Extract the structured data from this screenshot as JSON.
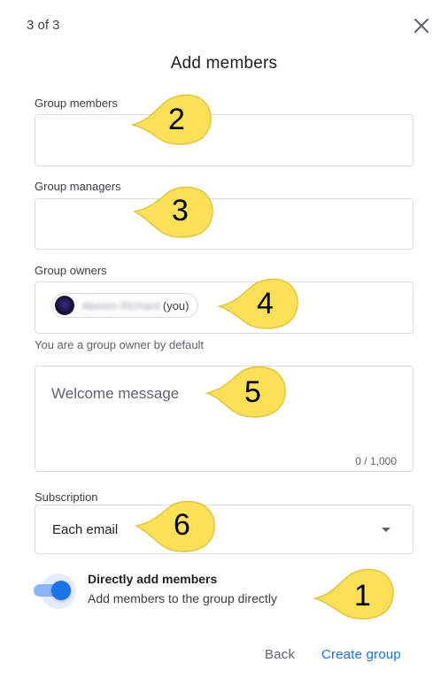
{
  "header": {
    "step": "3 of 3",
    "title": "Add members",
    "close_icon": "close-icon"
  },
  "fields": {
    "group_members": {
      "label": "Group members",
      "value": ""
    },
    "group_managers": {
      "label": "Group managers",
      "value": ""
    },
    "group_owners": {
      "label": "Group owners",
      "owner_chip": {
        "name": "Akeem Richard",
        "suffix": "(you)"
      },
      "hint": "You are a group owner by default"
    },
    "welcome_message": {
      "placeholder": "Welcome message",
      "counter": "0 / 1,000"
    },
    "subscription": {
      "label": "Subscription",
      "value": "Each email",
      "icon": "dropdown-arrow-icon"
    }
  },
  "toggle": {
    "state": "on",
    "title": "Directly add members",
    "description": "Add members to the group directly"
  },
  "actions": {
    "back": "Back",
    "create": "Create group"
  },
  "callouts": {
    "toggle": "1",
    "group_members": "2",
    "group_managers": "3",
    "group_owners": "4",
    "welcome_message": "5",
    "subscription": "6"
  },
  "colors": {
    "accent": "#1a73e8",
    "callout_fill": "#fce156",
    "callout_stroke": "#e2c53a",
    "border": "#dadce0"
  }
}
